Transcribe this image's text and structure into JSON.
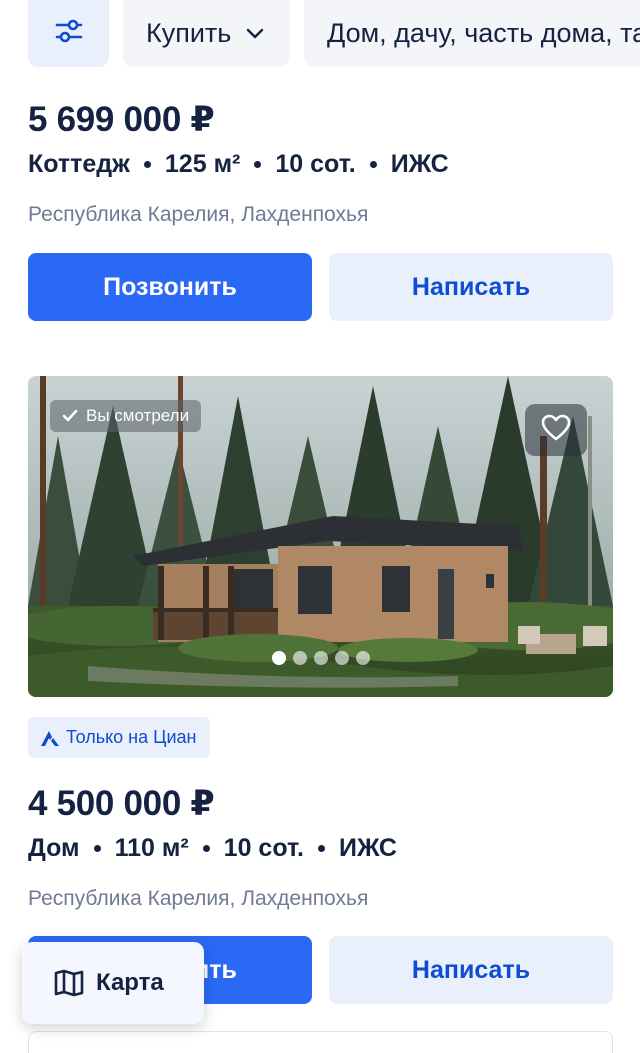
{
  "topbar": {
    "filter_icon": "sliders-icon",
    "deal_type": "Купить",
    "property_type": "Дом, дачу, часть дома, та"
  },
  "listings": [
    {
      "price": "5 699 000 ₽",
      "type": "Коттедж",
      "area": "125 м²",
      "land": "10 сот.",
      "status": "ИЖС",
      "address": "Республика Карелия, Лахденпохья",
      "call_label": "Позвонить",
      "message_label": "Написать"
    },
    {
      "viewed_label": "Вы смотрели",
      "exclusive_label": "Только на Циан",
      "photo_count": 5,
      "active_photo": 1,
      "price": "4 500 000 ₽",
      "type": "Дом",
      "area": "110 м²",
      "land": "10 сот.",
      "status": "ИЖС",
      "address": "Республика Карелия, Лахденпохья",
      "call_label": "Позвонить",
      "message_label": "Написать"
    }
  ],
  "map_button": {
    "label": "Карта",
    "icon": "map-icon"
  },
  "colors": {
    "primary": "#2a69f6",
    "primary_text": "#0d4cd3",
    "light_blue_bg": "#e9f0fb",
    "text": "#152242",
    "muted": "#707a95"
  }
}
